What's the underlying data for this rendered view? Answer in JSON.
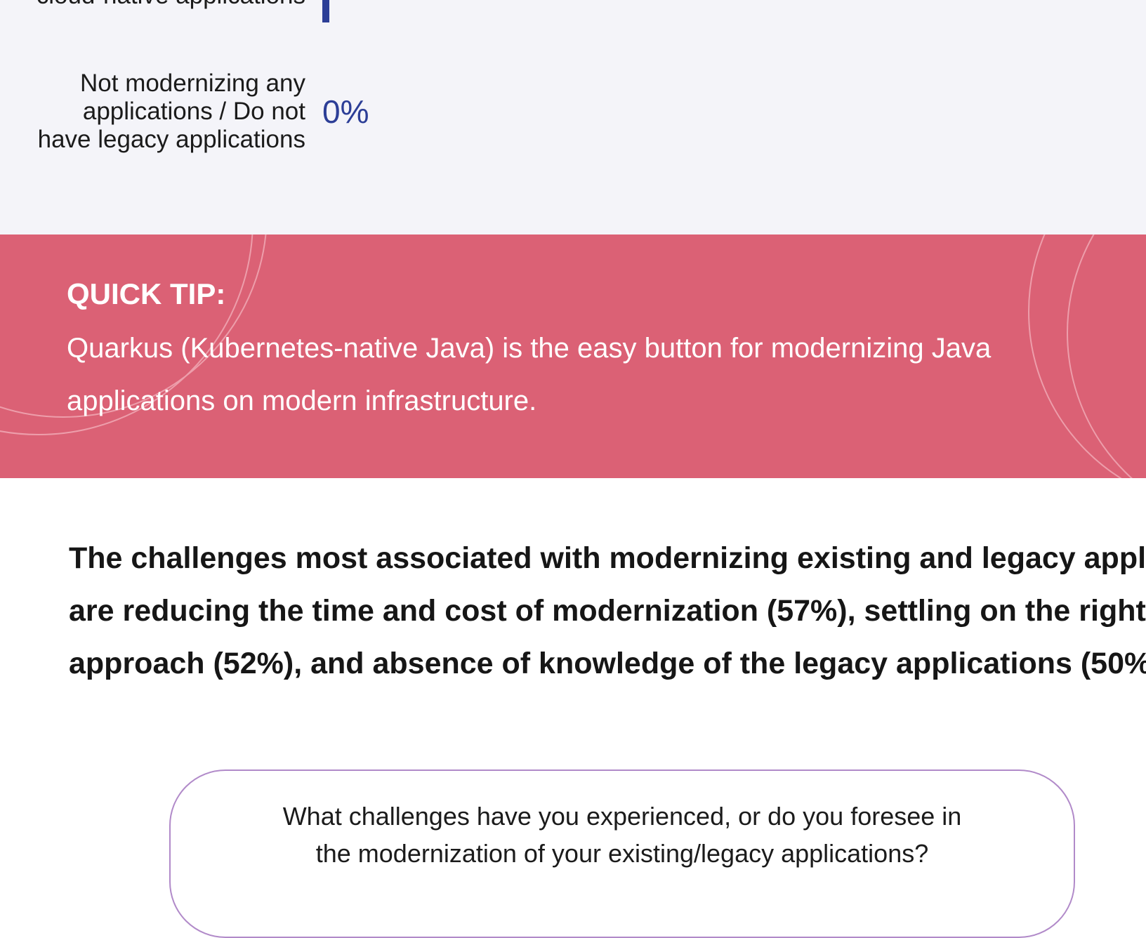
{
  "chart": {
    "top_row_label": "cloud-native applications",
    "row_label_lines": [
      "Not modernizing any",
      "applications / Do not",
      "have legacy applications"
    ],
    "row_value": "0%",
    "bar_color": "#2c3e97"
  },
  "tip": {
    "heading": "QUICK TIP:",
    "body_lines": [
      "Quarkus (Kubernetes-native Java) is the easy button for modernizing Java",
      "applications on modern infrastructure."
    ],
    "background_color": "#db6175"
  },
  "summary": {
    "lines": [
      "The challenges most associated with modernizing existing and legacy appl",
      "are reducing the time and cost of modernization (57%), settling on the right",
      "approach (52%), and absence of knowledge of the legacy applications (50%"
    ]
  },
  "question": {
    "lines": [
      "What challenges have you experienced, or do you foresee in",
      "the modernization of your existing/legacy applications?"
    ],
    "border_color": "#b18ac9"
  }
}
